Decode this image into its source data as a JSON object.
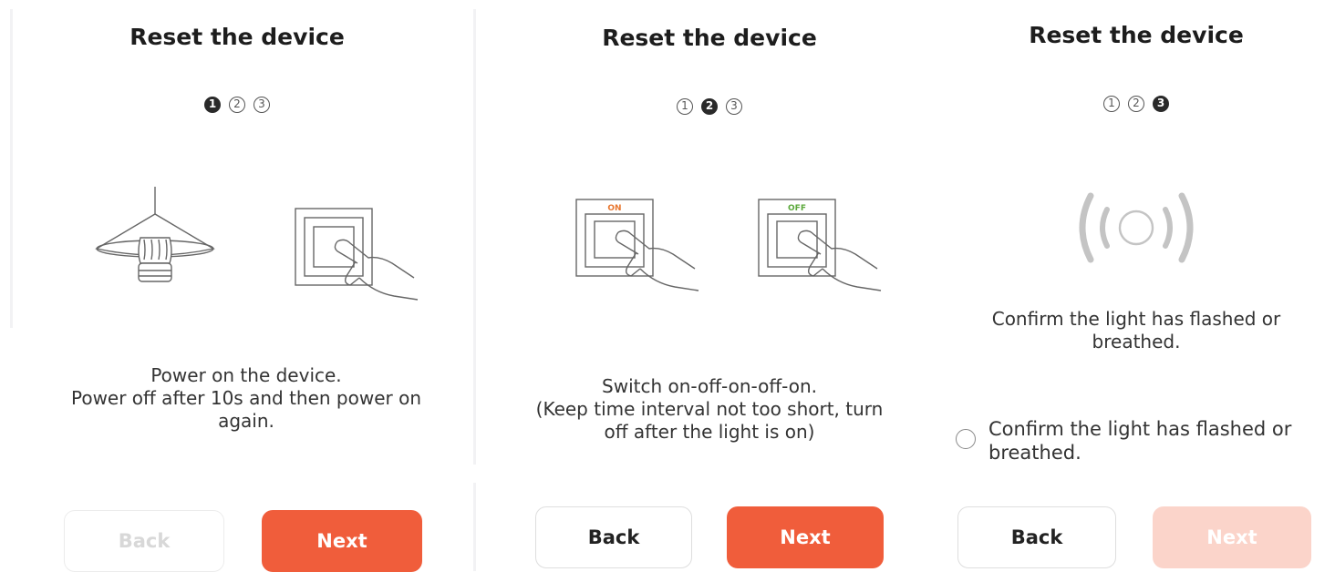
{
  "panels": [
    {
      "title": "Reset the device",
      "steps": [
        "1",
        "2",
        "3"
      ],
      "active_step": 1,
      "description_lines": [
        "Power on the device.",
        "Power off after 10s and then power on",
        "again."
      ],
      "back_label": "Back",
      "next_label": "Next",
      "back_disabled": true,
      "next_disabled": false
    },
    {
      "title": "Reset the device",
      "steps": [
        "1",
        "2",
        "3"
      ],
      "active_step": 2,
      "switch_labels": {
        "on": "ON",
        "off": "OFF"
      },
      "description_lines": [
        "Switch on-off-on-off-on.",
        "(Keep time interval not too short, turn",
        "off after the light is on)"
      ],
      "back_label": "Back",
      "next_label": "Next",
      "back_disabled": false,
      "next_disabled": false
    },
    {
      "title": "Reset the device",
      "steps": [
        "1",
        "2",
        "3"
      ],
      "active_step": 3,
      "description_lines": [
        "Confirm the light has flashed or",
        "breathed."
      ],
      "confirm_lines": [
        "Confirm the light has flashed or",
        "breathed."
      ],
      "confirm_checked": false,
      "back_label": "Back",
      "next_label": "Next",
      "back_disabled": false,
      "next_disabled": true
    }
  ],
  "colors": {
    "accent": "#f05d3b",
    "accent_disabled": "#fbd4ca",
    "on_label": "#e8762e",
    "off_label": "#5aa83a"
  }
}
